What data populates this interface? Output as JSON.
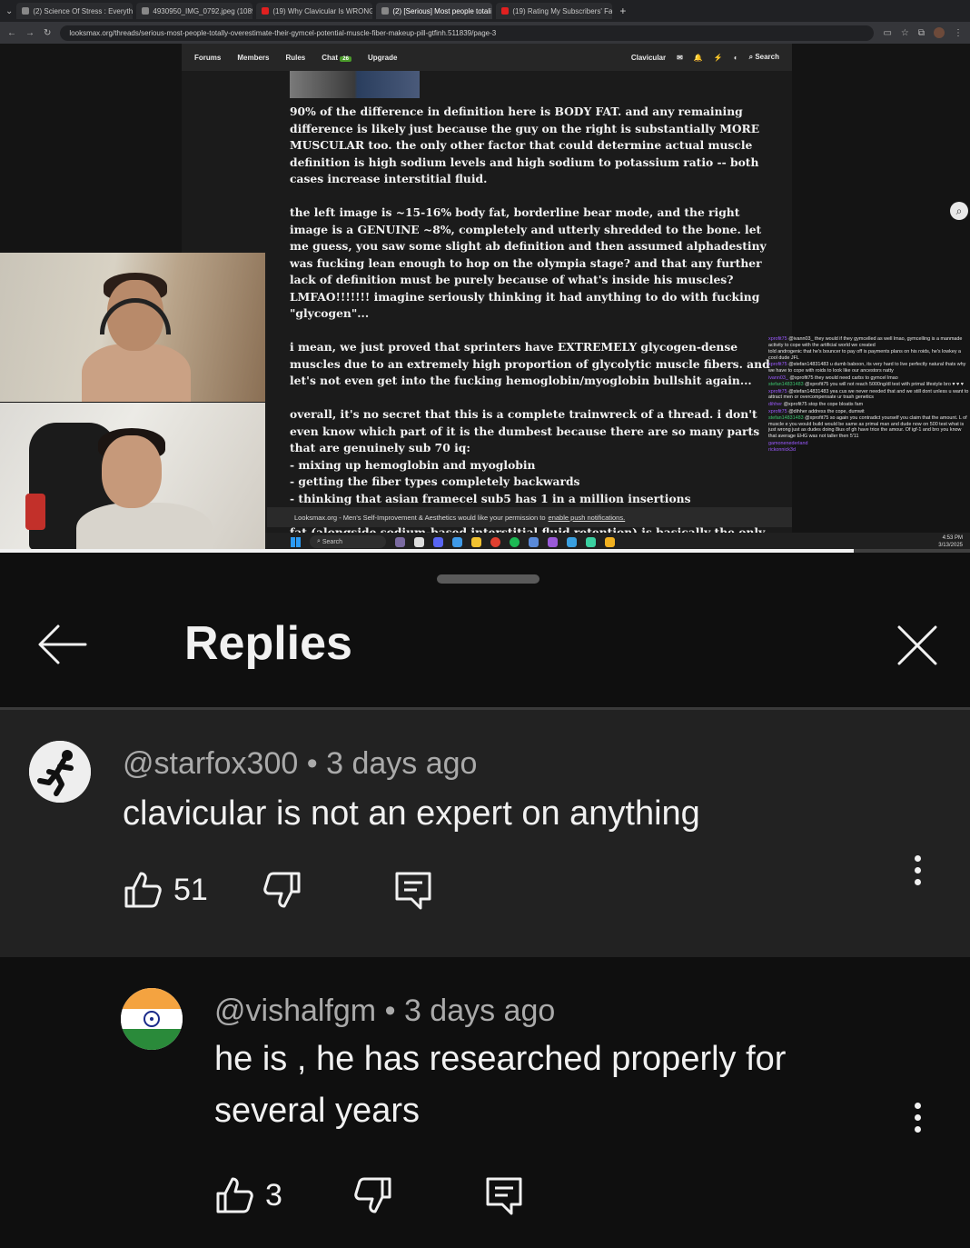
{
  "browser": {
    "tabs": [
      {
        "label": "(2) Science Of Stress : Everythin",
        "active": false
      },
      {
        "label": "4930950_IMG_0792.jpeg (1089",
        "active": false
      },
      {
        "label": "(19) Why Clavicular Is WRONG",
        "active": false
      },
      {
        "label": "(2) [Serious] Most people totali",
        "active": true
      },
      {
        "label": "(19) Rating My Subscribers' Fa",
        "active": false
      }
    ],
    "url": "looksmax.org/threads/serious-most-people-totally-overestimate-their-gymcel-potential-muscle-fiber-makeup-pill-gtfinh.511839/page-3"
  },
  "forum": {
    "nav": {
      "forums": "Forums",
      "members": "Members",
      "rules": "Rules",
      "chat": "Chat",
      "chat_badge": "26",
      "upgrade": "Upgrade",
      "user": "Clavicular",
      "search": "Search"
    },
    "post_paragraphs": [
      "90% of the difference in definition here is BODY FAT. and any remaining difference is likely just because the guy on the right is substantially MORE MUSCULAR too. the only other factor that could determine actual muscle definition is high sodium levels and high sodium to potassium ratio -- both cases increase interstitial fluid.",
      "the left image is ~15-16% body fat, borderline bear mode, and the right image is a GENUINE ~8%, completely and utterly shredded to the bone. let me guess, you saw some slight ab definition and then assumed alphadestiny was fucking lean enough to hop on the olympia stage? and that any further lack of definition must be purely because of what's inside his muscles? LMFAO!!!!!!! imagine seriously thinking it had anything to do with fucking \"glycogen\"...",
      "i mean, we just proved that sprinters have EXTREMELY glycogen-dense muscles due to an extremely high proportion of glycolytic muscle fibers. and let's not even get into the fucking hemoglobin/myoglobin bullshit again...",
      "overall, it's no secret that this is a complete trainwreck of a thread. i don't even know which part of it is the dumbest because there are so many parts that are genuinely sub 70 iq:"
    ],
    "post_list": [
      "- mixing up hemoglobin and myoglobin",
      "- getting the fiber types completely backwards",
      "- thinking that asian framecel sub5 has 1 in a million insertions",
      "- not understanding how body fat works even slightly and not realising body fat (alongside sodium-based interstitial fluid retention) is basically the only relevant"
    ],
    "notification_text": "Looksmax.org - Men's Self-Improvement & Aesthetics would like your permission to",
    "notification_link": "enable push notifications."
  },
  "taskbar": {
    "search": "Search",
    "time": "4:53 PM",
    "date": "3/13/2025"
  },
  "stream_chat": [
    {
      "user": "xprofit75",
      "text": "@ivann03_ they would if they gymcelled as well lmao, gymcelling is a manmade activity to cope with the artificial world we created"
    },
    {
      "user": "",
      "text": "told androgenic that he's bouncer to pay off is payments plans on his roids, he's lowkey a cool dude JFL"
    },
    {
      "user": "xprofit75",
      "text": "@stefan14831483 u dumb baboon, its very hard to live perfectly natural thats why we have to cope with roids to look like our ancestors natty"
    },
    {
      "user": "ivann03_",
      "text": "@xprofit75 they would need carbs to gymcel lmao"
    },
    {
      "user": "stefan14831483",
      "text": "@xprofit75 you will not reach 5000ng/dl test with primal lifestyle bro ♥ ♥ ♥"
    },
    {
      "user": "xprofit75",
      "text": "@stefan14831483 yea cus we never needed that and we still dont unless u want to attract men or overcompensate ur trash genetics"
    },
    {
      "user": "dihher",
      "text": "@xprofit75 stop the cope bloatis fam"
    },
    {
      "user": "xprofit75",
      "text": "@dihher address the cope, dumwit"
    },
    {
      "user": "stefan14831483",
      "text": "@xprofit75 so again you contradict yourself you claim that the amount. L of muscle e you would build would be same as primal man and dude now on 500 test what is just wrong just as dudes doing 8ius of gh have trice the amour. Of igf-1 and bro you know that average EHG was not taller then 5'11"
    },
    {
      "user": "gamonenederland",
      "text": ""
    },
    {
      "user": "rickonnick3d",
      "text": ""
    }
  ],
  "video": {
    "progress": 0.88
  },
  "replies_sheet": {
    "title": "Replies",
    "parent_comment": {
      "author": "@starfox300",
      "age": "3 days ago",
      "text": "clavicular is not an expert on anything",
      "likes": "51"
    },
    "reply_comment": {
      "author": "@vishalfgm",
      "age": "3 days ago",
      "text": "he is , he has researched properly for several years",
      "likes": "3"
    },
    "separator": "•"
  },
  "colors": {
    "sheet_bg": "#0f0f0f",
    "parent_bg": "#222222",
    "text_primary": "#f1f1f1",
    "text_secondary": "#aaaaaa"
  },
  "icons": [
    "back-arrow-icon",
    "close-icon",
    "more-vert-icon",
    "thumb-up-icon",
    "thumb-down-icon",
    "reply-icon",
    "search-icon"
  ]
}
